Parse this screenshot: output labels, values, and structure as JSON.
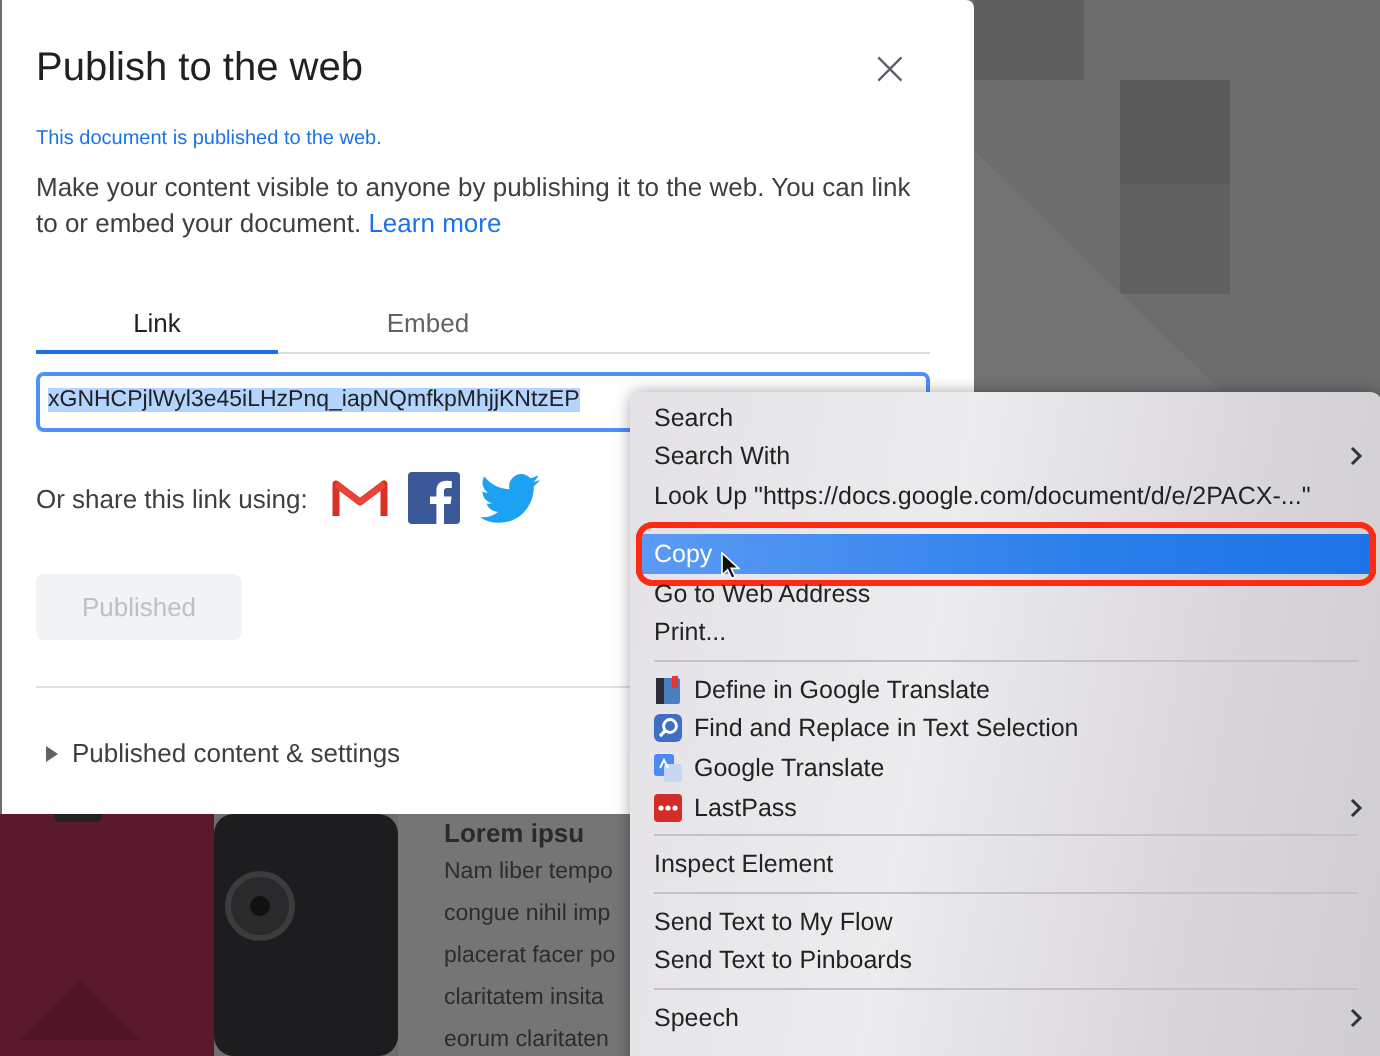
{
  "background_page": {
    "heading": "Lorem ipsu",
    "lines": [
      "Nam liber tempo",
      "congue nihil imp",
      "placerat facer po",
      "claritatem insita",
      "eorum claritaten"
    ]
  },
  "dialog": {
    "title": "Publish to the web",
    "close": "×",
    "status": "This document is published to the web.",
    "description": "Make your content visible to anyone by publishing it to the web. You can link to or embed your document.",
    "learn_more": "Learn more",
    "tabs": [
      {
        "label": "Link",
        "selected": true
      },
      {
        "label": "Embed",
        "selected": false
      }
    ],
    "link_field": {
      "value": "xGNHCPjlWyl3e45iLHzPnq_iapNQmfkpMhjjKNtzEP",
      "text_selected": true
    },
    "share_label": "Or share this link using:",
    "share_services": [
      {
        "kind": "gmail"
      },
      {
        "kind": "facebook"
      },
      {
        "kind": "twitter"
      }
    ],
    "publish_button": {
      "label": "Published",
      "disabled": true
    },
    "details": {
      "label": "Published content & settings",
      "expanded": false
    }
  },
  "context_menu": {
    "items": [
      {
        "kind": "item",
        "label": "Search",
        "submenu": false,
        "selected": false
      },
      {
        "kind": "item",
        "label": "Search With",
        "submenu": true,
        "selected": false
      },
      {
        "kind": "item",
        "label": "Look Up \"https://docs.google.com/document/d/e/2PACX-...\"",
        "submenu": false,
        "selected": false
      },
      {
        "kind": "separator"
      },
      {
        "kind": "item",
        "label": "Copy",
        "submenu": false,
        "selected": true,
        "outlined": true
      },
      {
        "kind": "item",
        "label": "Go to Web Address",
        "submenu": false,
        "selected": false
      },
      {
        "kind": "item",
        "label": "Print...",
        "submenu": false,
        "selected": false
      },
      {
        "kind": "separator"
      },
      {
        "kind": "book",
        "label": "Define in Google Translate",
        "submenu": false,
        "selected": false
      },
      {
        "kind": "lens",
        "label": "Find and Replace in Text Selection",
        "submenu": false,
        "selected": false
      },
      {
        "kind": "translate",
        "label": "Google Translate",
        "submenu": false,
        "selected": false
      },
      {
        "kind": "dots",
        "label": "LastPass",
        "submenu": true,
        "selected": false
      },
      {
        "kind": "separator"
      },
      {
        "kind": "item",
        "label": "Inspect Element",
        "submenu": false,
        "selected": false
      },
      {
        "kind": "separator"
      },
      {
        "kind": "item",
        "label": "Send Text to My Flow",
        "submenu": false,
        "selected": false
      },
      {
        "kind": "item",
        "label": "Send Text to Pinboards",
        "submenu": false,
        "selected": false
      },
      {
        "kind": "separator"
      },
      {
        "kind": "item",
        "label": "Speech",
        "submenu": true,
        "selected": false
      }
    ]
  }
}
